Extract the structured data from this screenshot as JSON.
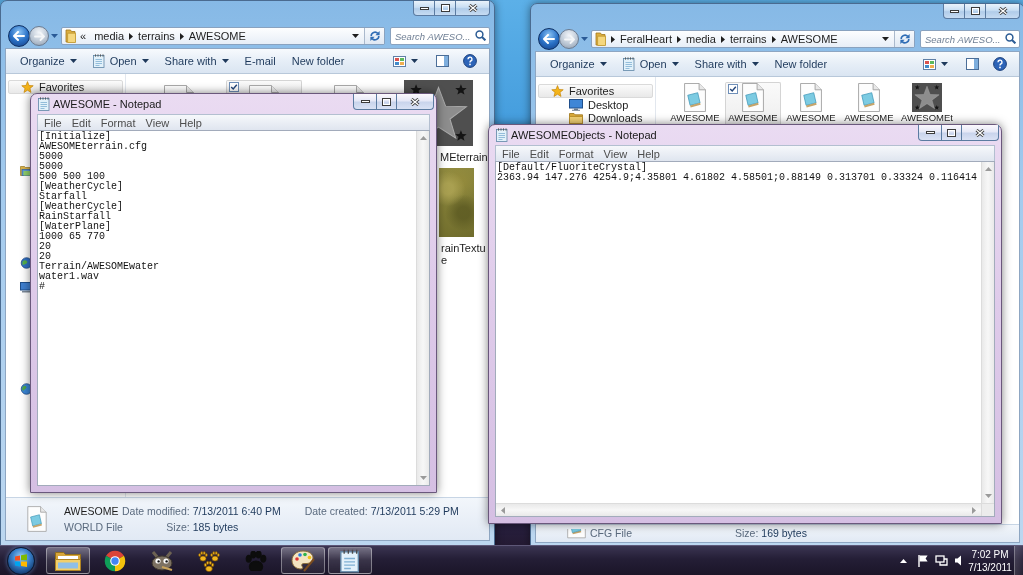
{
  "explorers": [
    {
      "address": {
        "overflow": "«",
        "crumbs": [
          "media",
          "terrains",
          "AWESOME"
        ]
      },
      "search": {
        "placeholder": "Search AWESO..."
      },
      "toolbar": [
        {
          "label": "Organize",
          "kind": "menu"
        },
        {
          "label": "Open",
          "kind": "app"
        },
        {
          "label": "Share with",
          "kind": "menu"
        },
        {
          "label": "E-mail",
          "kind": "plain"
        },
        {
          "label": "New folder",
          "kind": "plain"
        }
      ],
      "nav": [
        {
          "label": "Favorites",
          "kind": "header",
          "selected": true
        },
        {
          "kind": "libraries",
          "selected": false
        },
        {
          "kind": "homegroup",
          "selected": false
        },
        {
          "kind": "computer",
          "selected": false
        },
        {
          "kind": "network",
          "selected": false
        }
      ],
      "files": [
        {
          "kind": "document",
          "selected": false
        },
        {
          "kind": "document",
          "selected": true
        },
        {
          "kind": "document",
          "selected": false
        },
        {
          "kind": "star",
          "selected": false,
          "label": [
            "MEterrain"
          ]
        },
        {
          "kind": "grass",
          "selected": false,
          "label": [
            "rainTextu",
            "e"
          ]
        }
      ],
      "details": {
        "name": "AWESOME",
        "type": "WORLD File",
        "fields": [
          {
            "label": "Date modified:",
            "value": "7/13/2011 6:40 PM"
          },
          {
            "label": "Date created:",
            "value": "7/13/2011 5:29 PM"
          },
          {
            "label": "Size:",
            "value": "185 bytes"
          }
        ]
      }
    },
    {
      "address": {
        "crumbs": [
          "FeralHeart",
          "media",
          "terrains",
          "AWESOME"
        ]
      },
      "search": {
        "placeholder": "Search AWESO..."
      },
      "toolbar": [
        {
          "label": "Organize",
          "kind": "menu"
        },
        {
          "label": "Open",
          "kind": "app"
        },
        {
          "label": "Share with",
          "kind": "menu"
        },
        {
          "label": "New folder",
          "kind": "plain"
        }
      ],
      "nav": [
        {
          "label": "Favorites",
          "kind": "header",
          "selected": true
        },
        {
          "label": "Desktop",
          "kind": "desktop",
          "selected": false
        },
        {
          "label": "Downloads",
          "kind": "folder",
          "selected": false
        }
      ],
      "files": [
        {
          "kind": "document",
          "selected": false,
          "label": [
            "AWESOME"
          ]
        },
        {
          "kind": "document",
          "selected": true,
          "label": [
            "AWESOME"
          ]
        },
        {
          "kind": "document",
          "selected": false,
          "label": [
            "AWESOME"
          ]
        },
        {
          "kind": "document",
          "selected": false,
          "label": [
            "AWESOME"
          ]
        },
        {
          "kind": "star",
          "selected": false,
          "label": [
            "AWESOMEt"
          ]
        }
      ],
      "details": {
        "type": "CFG File",
        "fields": [
          {
            "label": "Size:",
            "value": "169 bytes"
          }
        ]
      }
    }
  ],
  "notepads": [
    {
      "title": "AWESOME - Notepad",
      "menu": [
        "File",
        "Edit",
        "Format",
        "View",
        "Help"
      ],
      "word_wrap": true,
      "lines": [
        "[Initialize]",
        "AWESOMEterrain.cfg",
        "5000",
        "5000",
        "500 500 100",
        "[WeatherCycle]",
        "Starfall",
        "[WeatherCycle]",
        "RainStarfall",
        "[WaterPlane]",
        "1000 65 770",
        "20",
        "20",
        "Terrain/AWESOMEwater",
        "water1.wav",
        "#"
      ]
    },
    {
      "title": "AWESOMEObjects - Notepad",
      "menu": [
        "File",
        "Edit",
        "Format",
        "View",
        "Help"
      ],
      "word_wrap": false,
      "lines": [
        "[Default/FluoriteCrystal]",
        "2363.94 147.276 4254.9;4.35801 4.61802 4.58501;0.88149 0.313701 0.33324 0.116414"
      ]
    }
  ],
  "taskbar": {
    "apps": [
      {
        "kind": "folder",
        "running": true
      },
      {
        "kind": "browser",
        "running": false
      },
      {
        "kind": "creature",
        "running": false
      },
      {
        "kind": "pawcluster",
        "running": false
      },
      {
        "kind": "paw",
        "running": false
      },
      {
        "kind": "palette",
        "running": true
      },
      {
        "kind": "notepad",
        "running": true
      }
    ],
    "time": "7:02 PM",
    "date": "7/13/2011"
  }
}
